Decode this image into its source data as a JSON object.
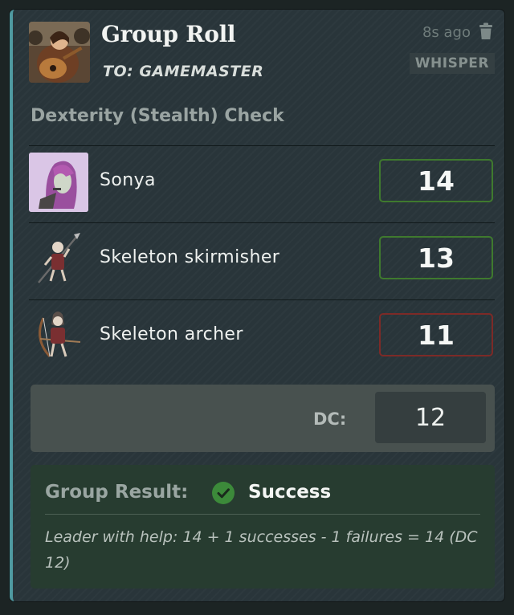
{
  "card": {
    "title": "Group Roll",
    "recipient": "TO: GAMEMASTER",
    "timestamp": "8s ago",
    "badge": "WHISPER",
    "accent_color": "#4f9aa1",
    "icons": {
      "delete": "trash-icon"
    }
  },
  "check": {
    "title": "Dexterity (Stealth) Check"
  },
  "rolls": [
    {
      "name": "Sonya",
      "total": "14",
      "status": "success"
    },
    {
      "name": "Skeleton skirmisher",
      "total": "13",
      "status": "success"
    },
    {
      "name": "Skeleton archer",
      "total": "11",
      "status": "failure"
    }
  ],
  "dc": {
    "label": "DC:",
    "value": "12"
  },
  "result": {
    "label": "Group Result:",
    "value": "Success",
    "icon": "check-circle-icon",
    "detail": "Leader with help: 14 + 1 successes - 1 failures = 14 (DC 12)"
  },
  "colors": {
    "success": "#3f7a2e",
    "failure": "#7d2a27"
  }
}
